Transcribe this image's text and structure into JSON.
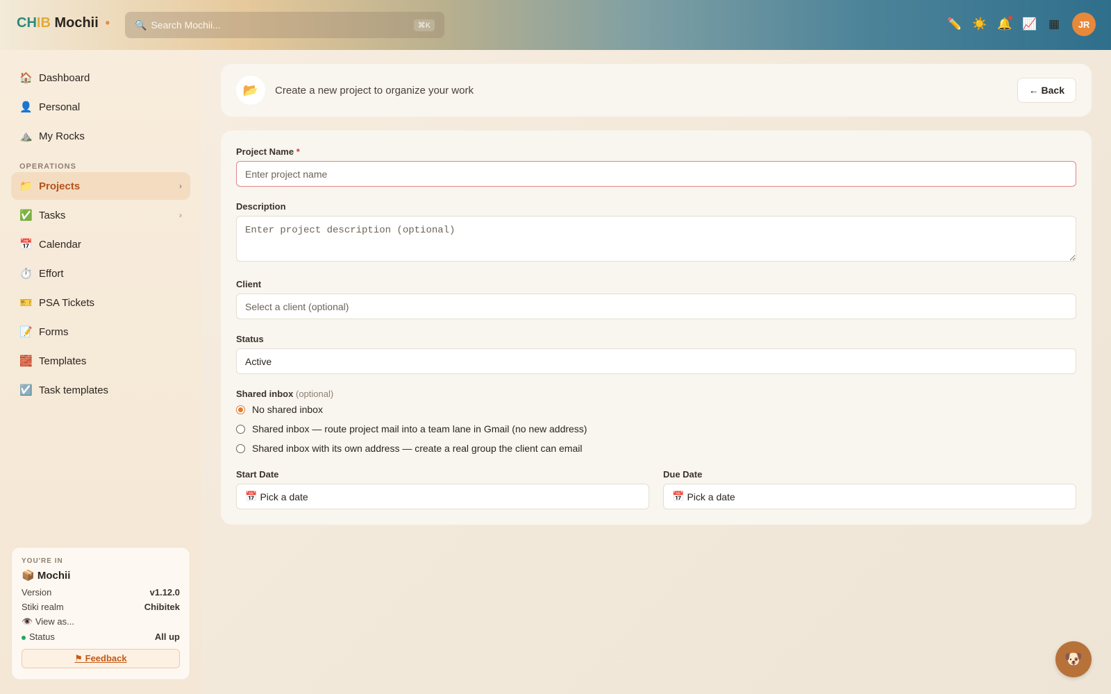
{
  "app": {
    "brand_part1": "CH",
    "brand_part2": "IB",
    "brand_part3": " Mochii",
    "brand_dot": "•"
  },
  "search": {
    "placeholder": "Search Mochii...",
    "shortcut": "⌘K"
  },
  "topbar": {
    "icons": [
      "pencil-icon",
      "sun-icon",
      "bell-icon",
      "chart-icon",
      "grid-icon"
    ],
    "avatar_initials": "JR"
  },
  "sidebar": {
    "items_top": [
      {
        "icon": "🏠",
        "label": "Dashboard"
      },
      {
        "icon": "👤",
        "label": "Personal"
      },
      {
        "icon": "⛰️",
        "label": "My Rocks"
      }
    ],
    "section_label": "OPERATIONS",
    "items_ops": [
      {
        "icon": "📁",
        "label": "Projects",
        "active": true,
        "chevron": "›"
      },
      {
        "icon": "✅",
        "label": "Tasks",
        "chevron": "›"
      },
      {
        "icon": "📅",
        "label": "Calendar"
      },
      {
        "icon": "⏱️",
        "label": "Effort"
      },
      {
        "icon": "🎫",
        "label": "PSA Tickets"
      },
      {
        "icon": "📝",
        "label": "Forms"
      },
      {
        "icon": "🧱",
        "label": "Templates"
      },
      {
        "icon": "☑️",
        "label": "Task templates"
      }
    ]
  },
  "info_card": {
    "youre_in": "YOU'RE IN",
    "org_icon": "📦",
    "org_name": "Mochii",
    "version_label": "Version",
    "version_value": "v1.12.0",
    "realm_label": "Stiki realm",
    "realm_value": "Chibitek",
    "view_as_icon": "👁️",
    "view_as": "View as...",
    "status_label": "Status",
    "status_value": "All up",
    "feedback": "⚑ Feedback"
  },
  "header": {
    "icon": "📂",
    "subtitle": "Create a new project to organize your work",
    "back": "← Back"
  },
  "form": {
    "project_name_label": "Project Name",
    "required_mark": "*",
    "project_name_placeholder": "Enter project name",
    "description_label": "Description",
    "description_placeholder": "Enter project description (optional)",
    "client_label": "Client",
    "client_placeholder": "Select a client (optional)",
    "status_label": "Status",
    "status_value": "Active",
    "shared_inbox_label": "Shared inbox",
    "shared_inbox_optional": "(optional)",
    "inbox_options": [
      {
        "label": "No shared inbox",
        "selected": true
      },
      {
        "label": "Shared inbox — route project mail into a team lane in Gmail (no new address)",
        "selected": false
      },
      {
        "label": "Shared inbox with its own address — create a real group the client can email",
        "selected": false
      }
    ],
    "start_date_label": "Start Date",
    "start_date_placeholder": "Pick a date",
    "due_date_label": "Due Date",
    "due_date_placeholder": "Pick a date",
    "date_icon": "📅"
  },
  "fab": {
    "icon": "🐶"
  }
}
